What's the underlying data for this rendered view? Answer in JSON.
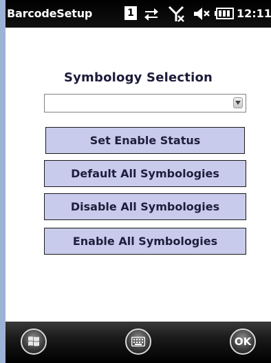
{
  "status_bar": {
    "app_title": "BarcodeSetup",
    "sim_label": "1",
    "time": "12:11",
    "icons": [
      "sim-card-icon",
      "data-sync-icon",
      "no-signal-icon",
      "speaker-muted-icon",
      "battery-icon"
    ]
  },
  "main": {
    "heading": "Symbology Selection",
    "dropdown_value": "",
    "buttons": {
      "set_enable_status": "Set Enable Status",
      "default_all": "Default All Symbologies",
      "disable_all": "Disable All Symbologies",
      "enable_all": "Enable All Symbologies"
    }
  },
  "bottom_bar": {
    "start": "windows-start-icon",
    "keyboard": "keyboard-icon",
    "ok_label": "OK"
  }
}
